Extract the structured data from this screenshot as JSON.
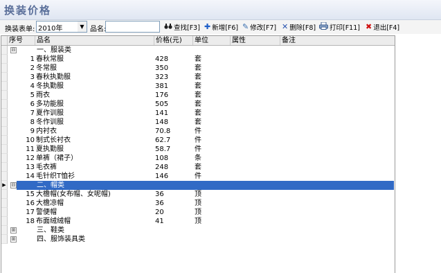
{
  "window": {
    "title": "换装价格"
  },
  "toolbar": {
    "table_label": "换装表单:",
    "table_value": "2010年",
    "name_label": "品名:",
    "name_value": "",
    "buttons": {
      "find": "查找[F3]",
      "add": "新增[F6]",
      "edit": "修改[F7]",
      "delete": "删除[F8]",
      "print": "打印[F11]",
      "exit": "退出[F4]"
    }
  },
  "grid": {
    "headers": {
      "seq": "序号",
      "name": "品名",
      "price": "价格(元)",
      "unit": "单位",
      "attr": "属性",
      "note": "备注"
    },
    "groups": [
      {
        "title": "一、服装类",
        "expanded": true,
        "items": [
          {
            "no": "1",
            "name": "春秋常服",
            "price": "428",
            "unit": "套"
          },
          {
            "no": "2",
            "name": "冬常服",
            "price": "350",
            "unit": "套"
          },
          {
            "no": "3",
            "name": "春秋执勤服",
            "price": "323",
            "unit": "套"
          },
          {
            "no": "4",
            "name": "冬执勤服",
            "price": "381",
            "unit": "套"
          },
          {
            "no": "5",
            "name": "雨衣",
            "price": "176",
            "unit": "套"
          },
          {
            "no": "6",
            "name": "多功能服",
            "price": "505",
            "unit": "套"
          },
          {
            "no": "7",
            "name": "夏作训服",
            "price": "141",
            "unit": "套"
          },
          {
            "no": "8",
            "name": "冬作训服",
            "price": "148",
            "unit": "套"
          },
          {
            "no": "9",
            "name": "内衬衣",
            "price": "70.8",
            "unit": "件"
          },
          {
            "no": "10",
            "name": "制式长衬衣",
            "price": "62.7",
            "unit": "件"
          },
          {
            "no": "11",
            "name": "夏执勤服",
            "price": "58.7",
            "unit": "件"
          },
          {
            "no": "12",
            "name": "单裤（裙子）",
            "price": "108",
            "unit": "条"
          },
          {
            "no": "13",
            "name": "毛衣裤",
            "price": "248",
            "unit": "套"
          },
          {
            "no": "14",
            "name": "毛针织T恤衫",
            "price": "146",
            "unit": "件"
          }
        ]
      },
      {
        "title": "二、帽类",
        "expanded": true,
        "selected": true,
        "items": [
          {
            "no": "15",
            "name": "大檐帽(女布帽、女呢帽)",
            "price": "36",
            "unit": "顶"
          },
          {
            "no": "16",
            "name": "大檐凉帽",
            "price": "36",
            "unit": "顶"
          },
          {
            "no": "17",
            "name": "警便帽",
            "price": "20",
            "unit": "顶"
          },
          {
            "no": "18",
            "name": "布面绒绒帽",
            "price": "41",
            "unit": "顶"
          }
        ]
      },
      {
        "title": "三、鞋类",
        "expanded": false,
        "items": []
      },
      {
        "title": "四、服饰装具类",
        "expanded": false,
        "items": []
      }
    ]
  },
  "glyphs": {
    "collapse": "⊟",
    "expand": "⊞",
    "row_pointer": "▶",
    "dropdown": "▼"
  },
  "colors": {
    "title": "#5a6f9a",
    "selection": "#316ac5",
    "find_icon": "#202020",
    "add_icon": "#1f5fc8",
    "edit_icon": "#3a6fb0",
    "delete_icon": "#2a55b0",
    "print_icon": "#406090",
    "exit_icon": "#d01010"
  }
}
